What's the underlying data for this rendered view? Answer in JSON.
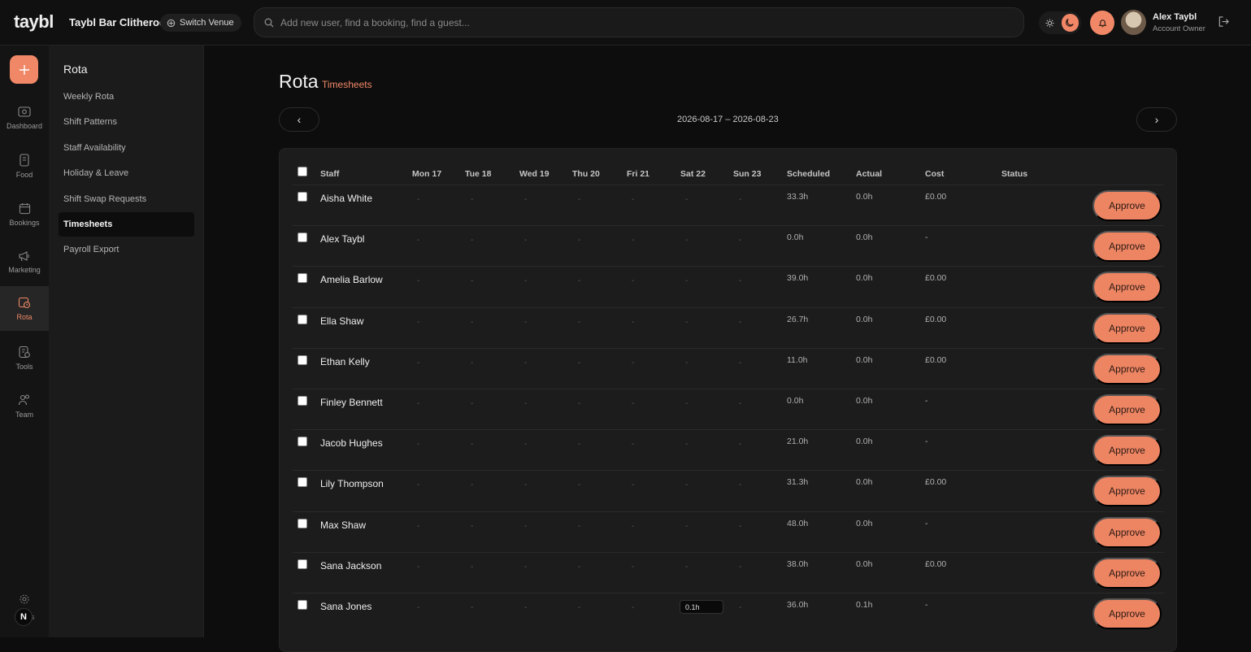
{
  "header": {
    "logo": "taybl",
    "venue_name": "Taybl Bar Clitheroe",
    "switch_venue_label": "Switch Venue",
    "search_placeholder": "Add new user, find a booking, find a guest...",
    "user_name": "Alex Taybl",
    "user_role": "Account Owner"
  },
  "rail": {
    "items": [
      {
        "label": "Dashboard",
        "icon": "dashboard-icon"
      },
      {
        "label": "Food",
        "icon": "food-icon"
      },
      {
        "label": "Bookings",
        "icon": "bookings-icon"
      },
      {
        "label": "Marketing",
        "icon": "megaphone-icon"
      },
      {
        "label": "Rota",
        "icon": "rota-icon",
        "active": true
      },
      {
        "label": "Tools",
        "icon": "tools-icon"
      },
      {
        "label": "Team",
        "icon": "team-icon"
      }
    ],
    "settings_label_partial": "s",
    "badge_letter": "N"
  },
  "subnav": {
    "title": "Rota",
    "items": [
      {
        "label": "Weekly Rota"
      },
      {
        "label": "Shift Patterns"
      },
      {
        "label": "Staff Availability"
      },
      {
        "label": "Holiday & Leave"
      },
      {
        "label": "Shift Swap Requests"
      },
      {
        "label": "Timesheets",
        "active": true
      },
      {
        "label": "Payroll Export"
      }
    ]
  },
  "page": {
    "title": "Rota",
    "subtitle": "Timesheets",
    "prev_label": "‹",
    "next_label": "›",
    "date_range": "2026-08-17 – 2026-08-23"
  },
  "table": {
    "headers": {
      "staff": "Staff",
      "days": [
        "Mon 17",
        "Tue 18",
        "Wed 19",
        "Thu 20",
        "Fri 21",
        "Sat 22",
        "Sun 23"
      ],
      "scheduled": "Scheduled",
      "actual": "Actual",
      "cost": "Cost",
      "status": "Status"
    },
    "approve_label": "Approve",
    "empty_day": "-",
    "rows": [
      {
        "name": "Aisha White",
        "scheduled": "33.3h",
        "actual": "0.0h",
        "cost": "£0.00"
      },
      {
        "name": "Alex Taybl",
        "scheduled": "0.0h",
        "actual": "0.0h",
        "cost": "-"
      },
      {
        "name": "Amelia Barlow",
        "scheduled": "39.0h",
        "actual": "0.0h",
        "cost": "£0.00"
      },
      {
        "name": "Ella Shaw",
        "scheduled": "26.7h",
        "actual": "0.0h",
        "cost": "£0.00"
      },
      {
        "name": "Ethan Kelly",
        "scheduled": "11.0h",
        "actual": "0.0h",
        "cost": "£0.00"
      },
      {
        "name": "Finley Bennett",
        "scheduled": "0.0h",
        "actual": "0.0h",
        "cost": "-"
      },
      {
        "name": "Jacob Hughes",
        "scheduled": "21.0h",
        "actual": "0.0h",
        "cost": "-"
      },
      {
        "name": "Lily Thompson",
        "scheduled": "31.3h",
        "actual": "0.0h",
        "cost": "£0.00"
      },
      {
        "name": "Max Shaw",
        "scheduled": "48.0h",
        "actual": "0.0h",
        "cost": "-"
      },
      {
        "name": "Sana Jackson",
        "scheduled": "38.0h",
        "actual": "0.0h",
        "cost": "£0.00"
      },
      {
        "name": "Sana Jones",
        "scheduled": "36.0h",
        "actual": "0.1h",
        "cost": "-",
        "sat_shift": "0.1h"
      }
    ]
  },
  "colors": {
    "accent": "#f08867",
    "background": "#0d0d0d",
    "card": "#1c1c1c"
  }
}
